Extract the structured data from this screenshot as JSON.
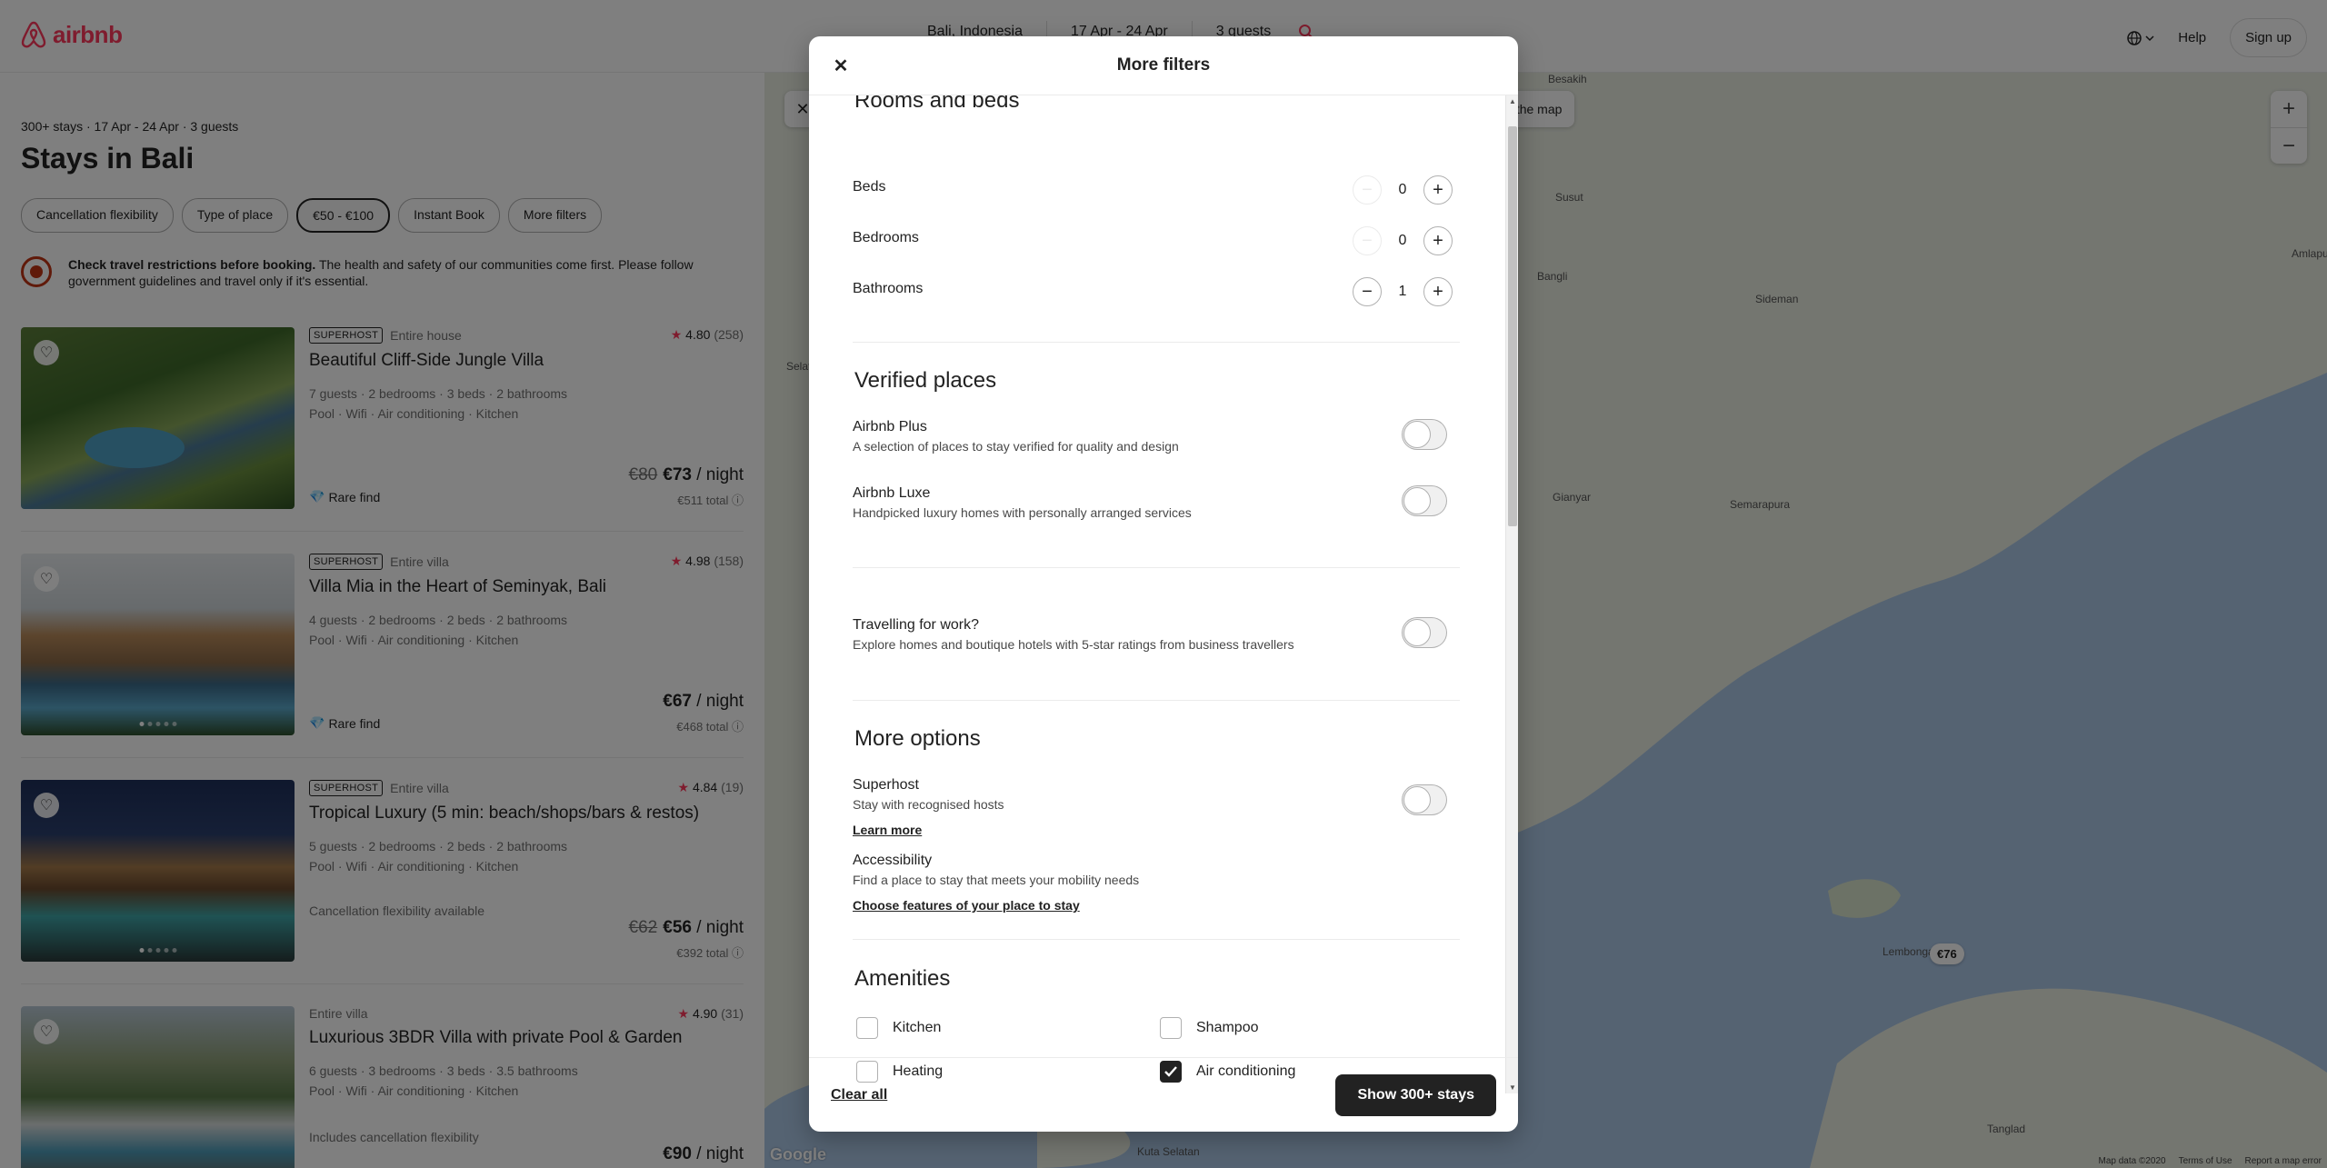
{
  "header": {
    "logo_text": "airbnb",
    "location": "Bali, Indonesia",
    "dates": "17 Apr - 24 Apr",
    "guests": "3 guests",
    "help": "Help",
    "signup": "Sign up"
  },
  "listing_page": {
    "meta": "300+ stays · 17 Apr - 24 Apr · 3 guests",
    "title": "Stays in Bali",
    "filters": [
      "Cancellation flexibility",
      "Type of place",
      "€50 - €100",
      "Instant Book",
      "More filters"
    ],
    "active_filter": "€50 - €100",
    "notice_bold": "Check travel restrictions before booking.",
    "notice_text": "The health and safety of our communities come first. Please follow government guidelines and travel only if it's essential."
  },
  "listings": [
    {
      "superhost": "SUPERHOST",
      "type": "Entire house",
      "rating": "4.80",
      "reviews": "(258)",
      "title": "Beautiful Cliff-Side Jungle Villa",
      "details1": "7 guests · 2 bedrooms · 3 beds · 2 bathrooms",
      "details2": "Pool · Wifi · Air conditioning · Kitchen",
      "tag": "Rare find",
      "old_price": "€80",
      "price": "€73",
      "per_night": "/ night",
      "total": "€511 total"
    },
    {
      "superhost": "SUPERHOST",
      "type": "Entire villa",
      "rating": "4.98",
      "reviews": "(158)",
      "title": "Villa Mia in the Heart of Seminyak, Bali",
      "details1": "4 guests · 2 bedrooms · 2 beds · 2 bathrooms",
      "details2": "Pool · Wifi · Air conditioning · Kitchen",
      "tag": "Rare find",
      "old_price": "",
      "price": "€67",
      "per_night": "/ night",
      "total": "€468 total"
    },
    {
      "superhost": "SUPERHOST",
      "type": "Entire villa",
      "rating": "4.84",
      "reviews": "(19)",
      "title": "Tropical Luxury (5 min: beach/shops/bars & restos)",
      "details1": "5 guests · 2 bedrooms · 2 beds · 2 bathrooms",
      "details2": "Pool · Wifi · Air conditioning · Kitchen",
      "tag": "Cancellation flexibility available",
      "old_price": "€62",
      "price": "€56",
      "per_night": "/ night",
      "total": "€392 total"
    },
    {
      "superhost": "",
      "type": "Entire villa",
      "rating": "4.90",
      "reviews": "(31)",
      "title": "Luxurious 3BDR Villa with private Pool & Garden",
      "details1": "6 guests · 3 bedrooms · 3 beds · 3.5 bathrooms",
      "details2": "Pool · Wifi · Air conditioning · Kitchen",
      "tag": "Includes cancellation flexibility",
      "old_price": "",
      "price": "€90",
      "per_night": "/ night",
      "total": ""
    }
  ],
  "map": {
    "search_as_move": "Search as I move the map",
    "labels": [
      "Besakih",
      "Susut",
      "Bangli",
      "Sideman",
      "Gianyar",
      "Semarapura",
      "Amlapura",
      "Lembongan",
      "Tanglad",
      "Kuta Selatan",
      "Selat"
    ],
    "price_pin": "€76",
    "footer": [
      "Map data ©2020",
      "Terms of Use",
      "Report a map error"
    ],
    "google": "Google"
  },
  "modal": {
    "title": "More filters",
    "rooms": {
      "heading": "Rooms and beds",
      "items": [
        {
          "label": "Beds",
          "value": "0",
          "minus_enabled": false
        },
        {
          "label": "Bedrooms",
          "value": "0",
          "minus_enabled": false
        },
        {
          "label": "Bathrooms",
          "value": "1",
          "minus_enabled": true
        }
      ]
    },
    "verified": {
      "heading": "Verified places",
      "plus_label": "Airbnb Plus",
      "plus_sub": "A selection of places to stay verified for quality and design",
      "luxe_label": "Airbnb Luxe",
      "luxe_sub": "Handpicked luxury homes with personally arranged services"
    },
    "work": {
      "label": "Travelling for work?",
      "sub": "Explore homes and boutique hotels with 5-star ratings from business travellers"
    },
    "more": {
      "heading": "More options",
      "superhost_label": "Superhost",
      "superhost_sub": "Stay with recognised hosts",
      "learn_more": "Learn more",
      "access_label": "Accessibility",
      "access_sub": "Find a place to stay that meets your mobility needs",
      "access_link": "Choose features of your place to stay"
    },
    "amenities": {
      "heading": "Amenities",
      "items": [
        {
          "label": "Kitchen",
          "checked": false
        },
        {
          "label": "Shampoo",
          "checked": false
        },
        {
          "label": "Heating",
          "checked": false
        },
        {
          "label": "Air conditioning",
          "checked": true
        }
      ]
    },
    "footer": {
      "clear_all": "Clear all",
      "show": "Show 300+ stays"
    }
  }
}
